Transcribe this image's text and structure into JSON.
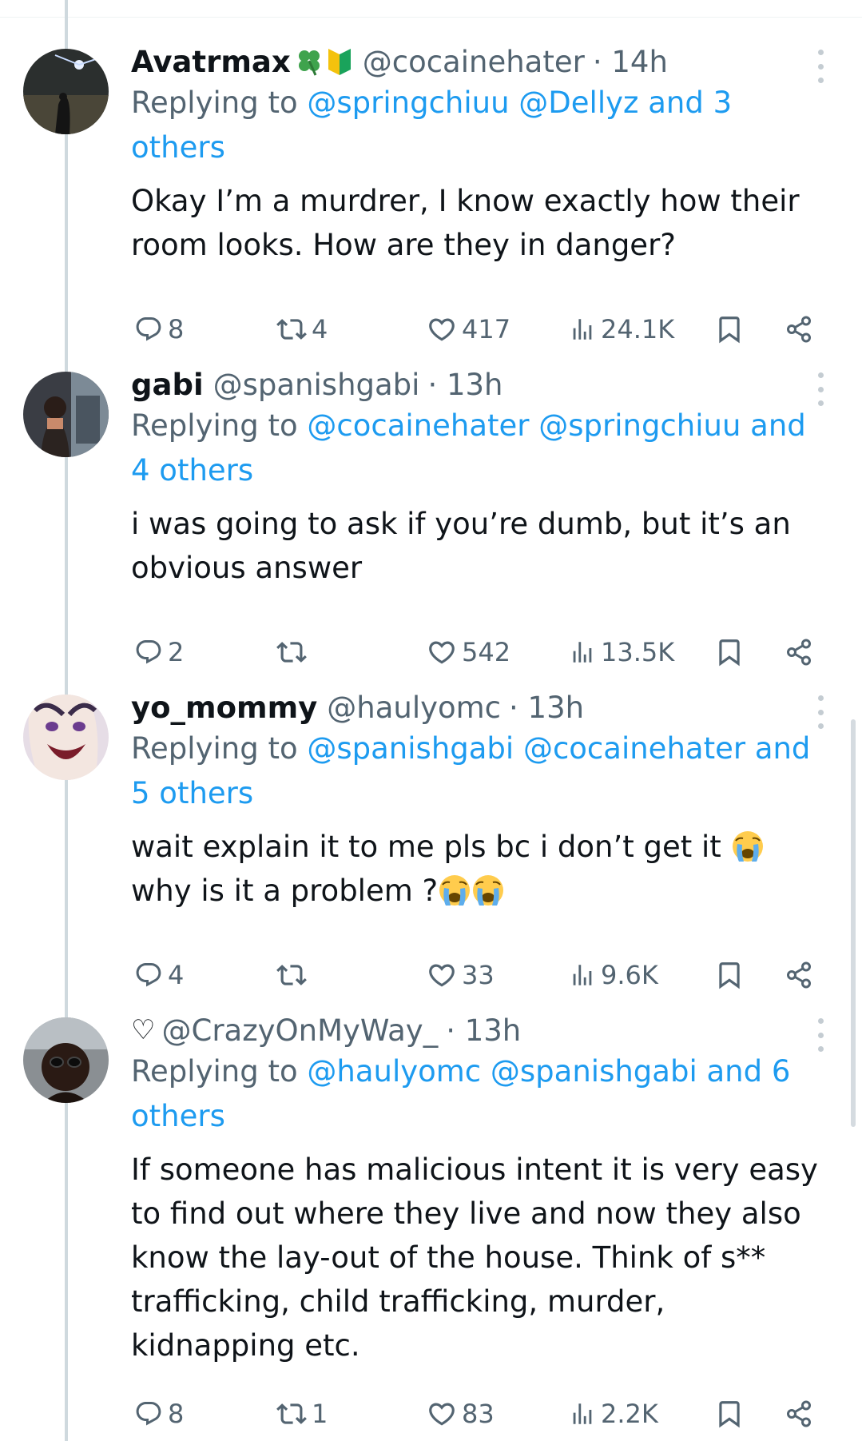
{
  "colors": {
    "accent": "#1d9bf0",
    "text": "#0f1419",
    "muted": "#536471",
    "thread": "#cfd9de"
  },
  "tweets": [
    {
      "name": "Avatrmax",
      "name_emojis": [
        "four-leaf-clover-icon",
        "beginner-badge-icon"
      ],
      "handle": "@cocainehater",
      "time": "· 14h",
      "replying_label": "Replying to",
      "replying_mentions": "@springchiuu @Dellyz and 3 others",
      "text": "Okay I’m a murdrer, I know exactly how their room looks. How are they in danger?",
      "replies": "8",
      "retweets": "4",
      "likes": "417",
      "views": "24.1K"
    },
    {
      "name": "gabi",
      "handle": "@spanishgabi",
      "time": "· 13h",
      "replying_label": "Replying to",
      "replying_mentions": "@cocainehater @springchiuu and 4 others",
      "text": "i was going to ask if you’re dumb, but it’s an obvious answer",
      "replies": "2",
      "retweets": "",
      "likes": "542",
      "views": "13.5K"
    },
    {
      "name": "yo_mommy",
      "handle": "@haulyomc",
      "time": "· 13h",
      "replying_label": "Replying to",
      "replying_mentions": "@spanishgabi @cocainehater and 5 others",
      "text_line1": "wait explain it to me pls bc i don’t get it",
      "text_line2": "why is it a problem ?",
      "text_emojis": [
        "loudly-crying-face-icon",
        "loudly-crying-face-icon",
        "loudly-crying-face-icon"
      ],
      "replies": "4",
      "retweets": "",
      "likes": "33",
      "views": "9.6K"
    },
    {
      "name": "♡",
      "handle": "@CrazyOnMyWay_",
      "time": "· 13h",
      "replying_label": "Replying to",
      "replying_mentions": "@haulyomc @spanishgabi and 6 others",
      "text": "If someone has malicious intent it is very easy to find out where they live and now they also know the lay-out of the house. Think of s** trafficking, child trafficking, murder, kidnapping etc.",
      "replies": "8",
      "retweets": "1",
      "likes": "83",
      "views": "2.2K"
    }
  ]
}
